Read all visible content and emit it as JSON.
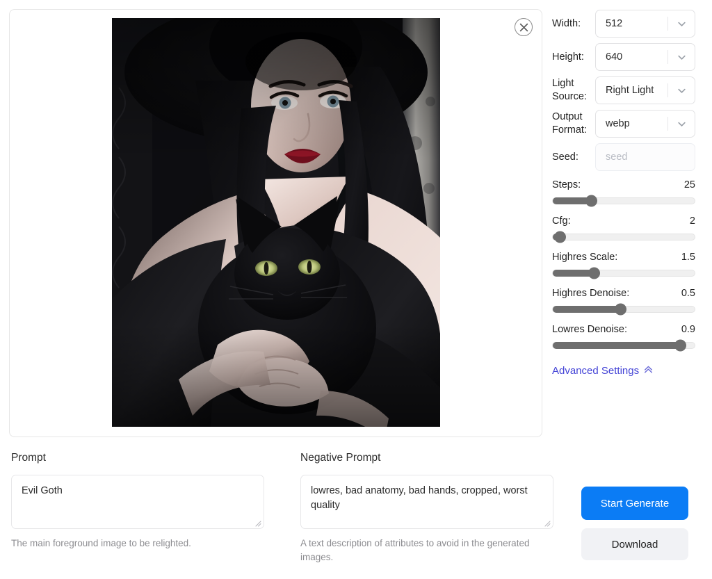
{
  "preview": {
    "close_icon": "close-circle-icon",
    "image_alt": "Generated gothic portrait of a pale woman in a wide black hat holding a black cat"
  },
  "settings": {
    "fields": [
      {
        "label": "Width:",
        "value": "512",
        "icon": "chevron-down-icon"
      },
      {
        "label": "Height:",
        "value": "640",
        "icon": "chevron-down-icon"
      },
      {
        "label": "Light Source:",
        "value": "Right Light",
        "icon": "chevron-down-icon"
      },
      {
        "label": "Output Format:",
        "value": "webp",
        "icon": "chevron-down-icon"
      }
    ],
    "seed": {
      "label": "Seed:",
      "value": "",
      "placeholder": "seed"
    },
    "sliders": [
      {
        "name": "Steps:",
        "value": "25",
        "percent": 27
      },
      {
        "name": "Cfg:",
        "value": "2",
        "percent": 5
      },
      {
        "name": "Highres Scale:",
        "value": "1.5",
        "percent": 29
      },
      {
        "name": "Highres Denoise:",
        "value": "0.5",
        "percent": 48
      },
      {
        "name": "Lowres Denoise:",
        "value": "0.9",
        "percent": 90
      }
    ],
    "advanced": {
      "label": "Advanced Settings",
      "icon": "chevron-double-up-icon",
      "color": "#4343d6"
    }
  },
  "prompt": {
    "title": "Prompt",
    "value": "Evil Goth",
    "helper": "The main foreground image to be relighted."
  },
  "negative_prompt": {
    "title": "Negative Prompt",
    "value": "lowres, bad anatomy, bad hands, cropped, worst quality",
    "helper": "A text description of attributes to avoid in the generated images."
  },
  "actions": {
    "generate_label": "Start Generate",
    "generate_color": "#0b7cf5",
    "download_label": "Download"
  }
}
